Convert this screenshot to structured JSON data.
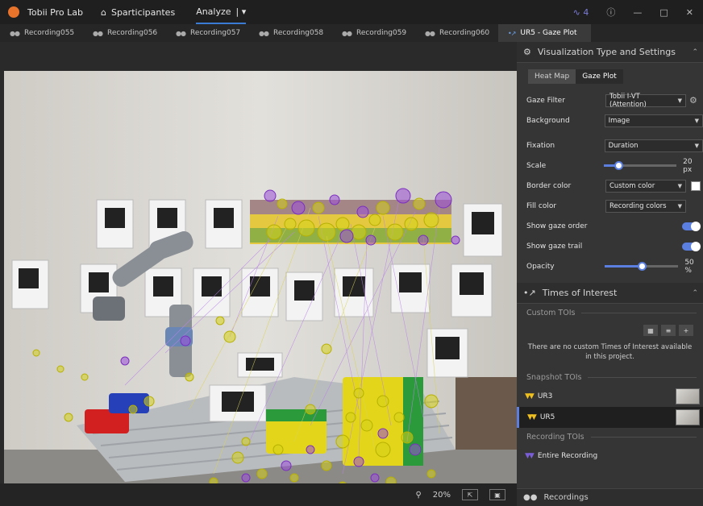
{
  "app": {
    "title": "Tobii Pro Lab",
    "menu": [
      {
        "label": "Sparticipantes",
        "icon": "home-icon"
      },
      {
        "label": "Analyze",
        "icon": "dropdown-icon"
      }
    ],
    "status_count": "4"
  },
  "tabs": [
    {
      "label": "Recording055"
    },
    {
      "label": "Recording056"
    },
    {
      "label": "Recording057"
    },
    {
      "label": "Recording058"
    },
    {
      "label": "Recording059"
    },
    {
      "label": "Recording060"
    },
    {
      "label": "UR5 - Gaze Plot",
      "active": true
    }
  ],
  "viewer": {
    "zoom": "20%"
  },
  "panel": {
    "viz_title": "Visualization Type and Settings",
    "viz_types": [
      "Heat Map",
      "Gaze Plot"
    ],
    "viz_selected": "Gaze Plot",
    "settings": {
      "gaze_filter_label": "Gaze Filter",
      "gaze_filter_value": "Tobii I-VT (Attention)",
      "background_label": "Background",
      "background_value": "Image",
      "fixation_label": "Fixation",
      "fixation_value": "Duration",
      "scale_label": "Scale",
      "scale_value": "20 px",
      "scale_level": 0.2,
      "border_color_label": "Border color",
      "border_color_value": "Custom color",
      "fill_color_label": "Fill color",
      "fill_color_value": "Recording colors",
      "show_gaze_order_label": "Show gaze order",
      "show_gaze_trail_label": "Show gaze trail",
      "opacity_label": "Opacity",
      "opacity_value": "50 %",
      "opacity_level": 0.5
    },
    "toi_title": "Times of Interest",
    "custom_tois_label": "Custom TOIs",
    "no_custom_msg": "There are no custom Times of Interest available in this project.",
    "snapshot_tois_label": "Snapshot TOIs",
    "snapshots": [
      {
        "label": "UR3",
        "selected": false
      },
      {
        "label": "UR5",
        "selected": true
      }
    ],
    "recording_tois_label": "Recording TOIs",
    "recording_toi": "Entire Recording",
    "recordings_title": "Recordings"
  },
  "colors": {
    "accent": "#5b7fe0",
    "fixation_yellow": "#d6d21a",
    "fixation_purple": "#9b4fd8"
  }
}
